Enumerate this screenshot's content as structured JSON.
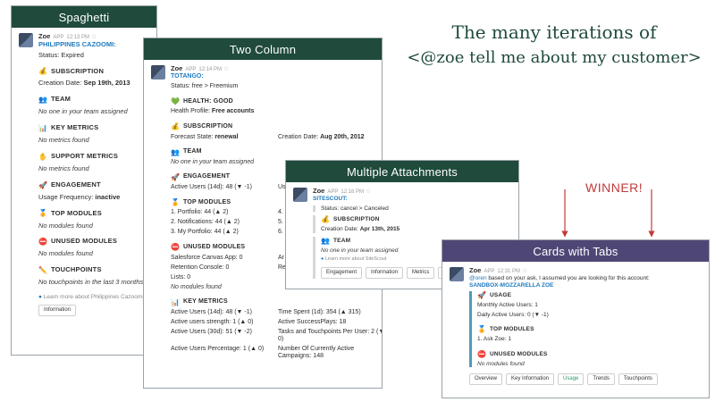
{
  "headline": {
    "line1": "The many iterations of",
    "line2": "<@zoe tell me about my customer>"
  },
  "winner_label": "WINNER!",
  "colors": {
    "green_header": "#1f4a3c",
    "purple_header": "#4e4776",
    "link": "#1f7abf",
    "winner": "#c23a3a"
  },
  "spaghetti": {
    "title": "Spaghetti",
    "bot": "Zoe",
    "app": "APP",
    "time": "12:13 PM",
    "customer": "PHILIPPINES CAZOOMI:",
    "status": "Status: Expired",
    "sections": [
      {
        "icon": "money-bag-icon",
        "glyph": "💰",
        "title": "SUBSCRIPTION",
        "label": "Creation Date:",
        "value": "Sep 19th, 2013"
      },
      {
        "icon": "people-icon",
        "glyph": "👥",
        "title": "TEAM",
        "text": "No one in your team assigned"
      },
      {
        "icon": "bar-chart-icon",
        "glyph": "📊",
        "title": "KEY METRICS",
        "text": "No metrics found"
      },
      {
        "icon": "hand-icon",
        "glyph": "✋",
        "title": "SUPPORT METRICS",
        "text": "No metrics found"
      },
      {
        "icon": "rocket-icon",
        "glyph": "🚀",
        "title": "ENGAGEMENT",
        "label": "Usage Frequency:",
        "value": "inactive"
      },
      {
        "icon": "medal-icon",
        "glyph": "🏅",
        "title": "TOP MODULES",
        "text": "No modules found"
      },
      {
        "icon": "no-entry-icon",
        "glyph": "⛔",
        "title": "UNUSED MODULES",
        "text": "No modules found"
      },
      {
        "icon": "pencil-icon",
        "glyph": "✏️",
        "title": "TOUCHPOINTS",
        "text": "No touchpoints in the last 3 months"
      }
    ],
    "learn_more": "Learn more about Philippines Cazoomi",
    "button": "Information"
  },
  "two_column": {
    "title": "Two Column",
    "bot": "Zoe",
    "app": "APP",
    "time": "12:14 PM",
    "customer": "TOTANGO:",
    "status": "Status: free > Freemium",
    "health_title": "HEALTH: GOOD",
    "health_profile_label": "Health Profile:",
    "health_profile_value": "Free accounts",
    "subscription_title": "SUBSCRIPTION",
    "forecast_label": "Forecast State:",
    "forecast_value": "renewal",
    "creation_label": "Creation Date:",
    "creation_value": "Aug 20th, 2012",
    "team_title": "TEAM",
    "team_text": "No one in your team assigned",
    "engagement_title": "ENGAGEMENT",
    "engagement_row": "Active Users (14d): 48 (▼ -1)",
    "engagement_right": "Us",
    "top_modules_title": "TOP MODULES",
    "top_modules": [
      {
        "left": "1. Portfolio: 44 (▲ 2)",
        "right": "4."
      },
      {
        "left": "2. Notifications: 44 (▲ 2)",
        "right": "5."
      },
      {
        "left": "3. My Portfolio: 44 (▲ 2)",
        "right": "6."
      }
    ],
    "unused_title": "UNUSED MODULES",
    "unused": [
      {
        "left": "Salesforce Canvas App: 0",
        "right": "Ar"
      },
      {
        "left": "Retention Console: 0",
        "right": "Re"
      },
      {
        "left": "Lists: 0",
        "right": ""
      }
    ],
    "unused_none": "No modules found",
    "key_metrics_title": "KEY METRICS",
    "key_metrics": [
      {
        "left": "Active Users (14d): 48 (▼ -1)",
        "right": "Time Spent (1d): 354 (▲ 315)"
      },
      {
        "left": "Active users strength: 1 (▲ 0)",
        "right": "Active SuccessPlays: 18"
      },
      {
        "left": "Active Users (30d): 51 (▼ -2)",
        "right": "Tasks and Touchpoints Per User: 2 (▼ 0)"
      },
      {
        "left": "Active Users Percentage: 1 (▲ 0)",
        "right": "Number Of Currently Active Campaigns: 148"
      }
    ]
  },
  "multiple": {
    "title": "Multiple Attachments",
    "bot": "Zoe",
    "app": "APP",
    "time": "12:16 PM",
    "customer": "SITESCOUT:",
    "status": "Status: cancel > Canceled",
    "subscription_title": "SUBSCRIPTION",
    "creation_label": "Creation Date:",
    "creation_value": "Apr 13th, 2015",
    "team_title": "TEAM",
    "team_text": "No one in your team assigned",
    "learn_more": "Learn more about SiteScout",
    "buttons": [
      "Engagement",
      "Information",
      "Metrics",
      "Touchpoints"
    ]
  },
  "cards": {
    "title": "Cards with Tabs",
    "bot": "Zoe",
    "app": "APP",
    "time": "12:31 PM",
    "mention": "@oren",
    "intro": " based on your ask, I assumed you are looking for this account:",
    "customer": "SANDBOX-MOZZARELLA ZOE",
    "usage_title": "USAGE",
    "usage_rows": [
      "Monthly Active Users: 1",
      "Daily Active Users: 0 (▼ -1)"
    ],
    "top_modules_title": "TOP MODULES",
    "top_modules": [
      "1. Ask Zoe: 1"
    ],
    "unused_title": "UNUSED MODULES",
    "unused_text": "No modules found",
    "tabs": [
      "Overview",
      "Key Information",
      "Usage",
      "Trends",
      "Touchpoints"
    ],
    "selected_tab": "Usage"
  }
}
